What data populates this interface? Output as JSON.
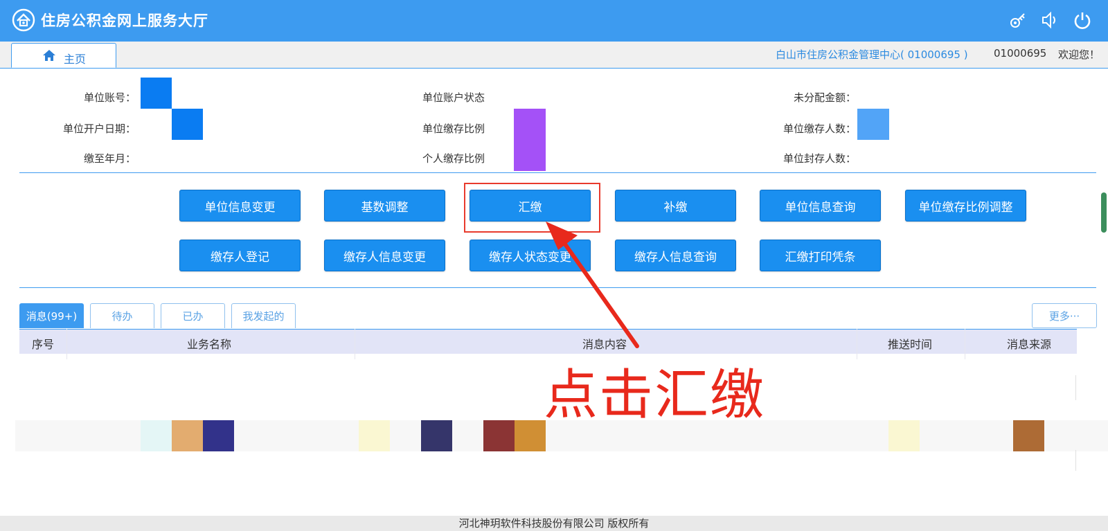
{
  "header": {
    "title": "住房公积金网上服务大厅",
    "icons": [
      "house-logo-icon",
      "key-icon",
      "speaker-icon",
      "power-icon"
    ]
  },
  "tabbar": {
    "home_tab": "主页",
    "center": "白山市住房公积金管理中心( 01000695 )",
    "user": "01000695",
    "welcome": "欢迎您！"
  },
  "info": {
    "account_no": "单位账号：",
    "open_date": "单位开户日期：",
    "paid_to": "缴至年月：",
    "account_status": "单位账户状态",
    "unit_ratio": "单位缴存比例",
    "personal_ratio": "个人缴存比例",
    "unallocated": "未分配金额：",
    "depositors": "单位缴存人数：",
    "sealed": "单位封存人数："
  },
  "actions": {
    "row1": [
      "单位信息变更",
      "基数调整",
      "汇缴",
      "补缴",
      "单位信息查询",
      "单位缴存比例调整"
    ],
    "row2": [
      "缴存人登记",
      "缴存人信息变更",
      "缴存人状态变更",
      "缴存人信息查询",
      "汇缴打印凭条"
    ]
  },
  "messages": {
    "tabs": [
      "消息(99+)",
      "待办",
      "已办",
      "我发起的"
    ],
    "more": "更多···",
    "columns": [
      "序号",
      "业务名称",
      "消息内容",
      "推送时间",
      "消息来源"
    ]
  },
  "annotation": "点击汇缴",
  "footer": "河北神玥软件科技股份有限公司 版权所有",
  "colors": {
    "primary": "#3d9bf0",
    "button": "#1a8ff0",
    "annotation": "#e8291c"
  }
}
